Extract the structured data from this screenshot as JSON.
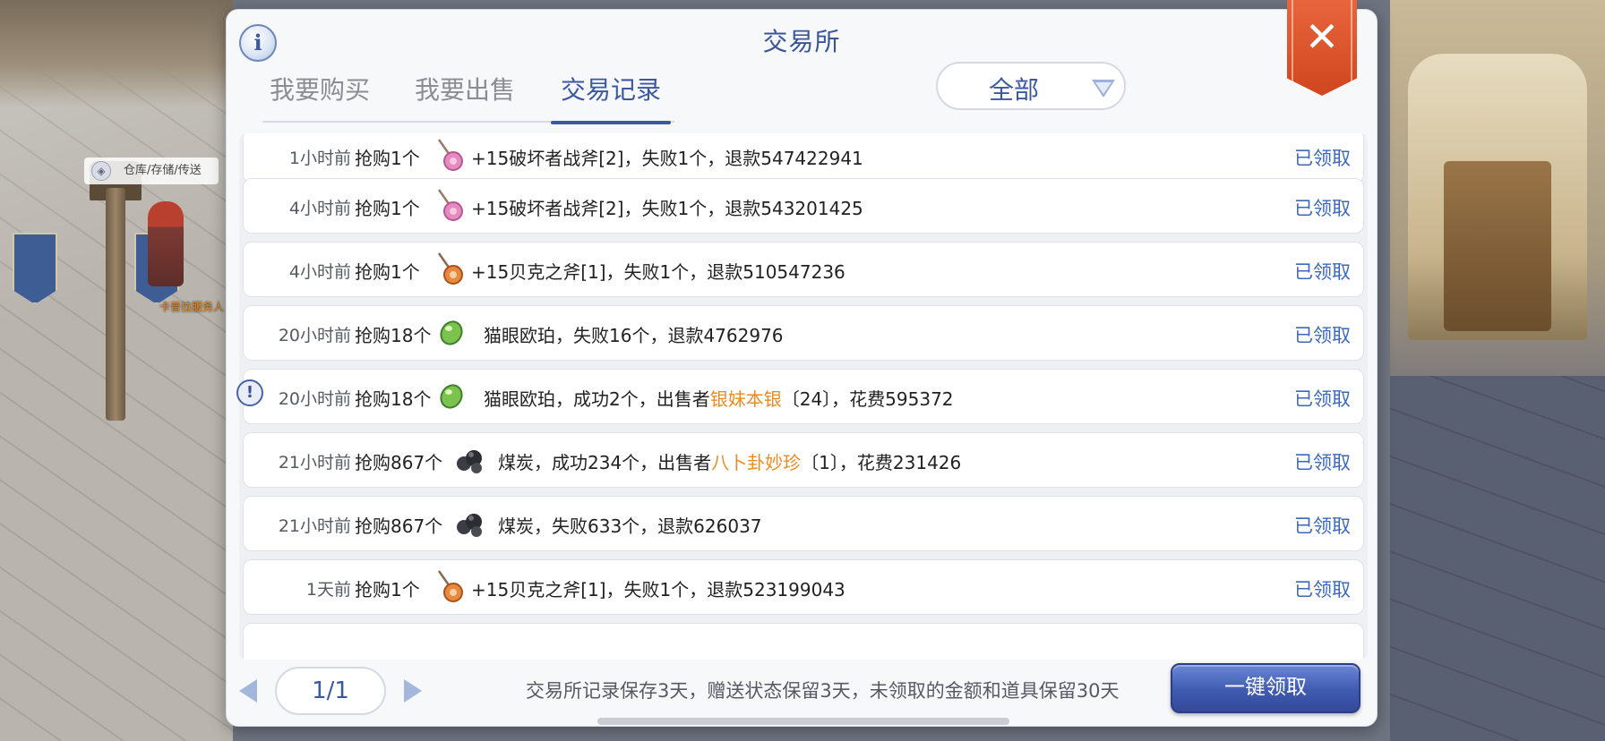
{
  "scene": {
    "npc_tag": "仓库/存储/传送",
    "npc_name": "卡普拉服务人"
  },
  "panel": {
    "title": "交易所",
    "tabs": [
      {
        "label": "我要购买",
        "active": false
      },
      {
        "label": "我要出售",
        "active": false
      },
      {
        "label": "交易记录",
        "active": true
      }
    ],
    "filter": {
      "selected": "全部"
    }
  },
  "records": [
    {
      "time": "1小时前",
      "action": "抢购1个",
      "icon": "axe-pink-icon",
      "text": "+15破坏者战斧[2]，失败1个，退款547422941",
      "status": "已领取"
    },
    {
      "time": "4小时前",
      "action": "抢购1个",
      "icon": "axe-pink-icon",
      "text": "+15破坏者战斧[2]，失败1个，退款543201425",
      "status": "已领取"
    },
    {
      "time": "4小时前",
      "action": "抢购1个",
      "icon": "axe-orange-icon",
      "text": "+15贝克之斧[1]，失败1个，退款510547236",
      "status": "已领取"
    },
    {
      "time": "20小时前",
      "action": "抢购18个",
      "icon": "green-gem-icon",
      "text": "猫眼欧珀，失败16个，退款4762976",
      "status": "已领取"
    },
    {
      "time": "20小时前",
      "action": "抢购18个",
      "icon": "green-gem-icon",
      "text_before": "猫眼欧珀，成功2个，出售者",
      "seller": "银妹本银",
      "text_after": "〔24〕，花费595372",
      "status": "已领取"
    },
    {
      "time": "21小时前",
      "action": "抢购867个",
      "icon": "coal-icon",
      "text_before": "煤炭，成功234个，出售者",
      "seller": "八卜卦妙珍",
      "text_after": "〔1〕，花费231426",
      "status": "已领取"
    },
    {
      "time": "21小时前",
      "action": "抢购867个",
      "icon": "coal-icon",
      "text": "煤炭，失败633个，退款626037",
      "status": "已领取"
    },
    {
      "time": "1天前",
      "action": "抢购1个",
      "icon": "axe-orange-icon",
      "text": "+15贝克之斧[1]，失败1个，退款523199043",
      "status": "已领取"
    }
  ],
  "footer": {
    "page": "1/1",
    "note": "交易所记录保存3天，赠送状态保留3天，未领取的金额和道具保留30天",
    "claim_all_label": "一键领取"
  },
  "colors": {
    "accent": "#3b58a3",
    "status_claimed": "#3b68bf",
    "seller_name": "#ef8a1d",
    "close_button": "#d9512a"
  }
}
